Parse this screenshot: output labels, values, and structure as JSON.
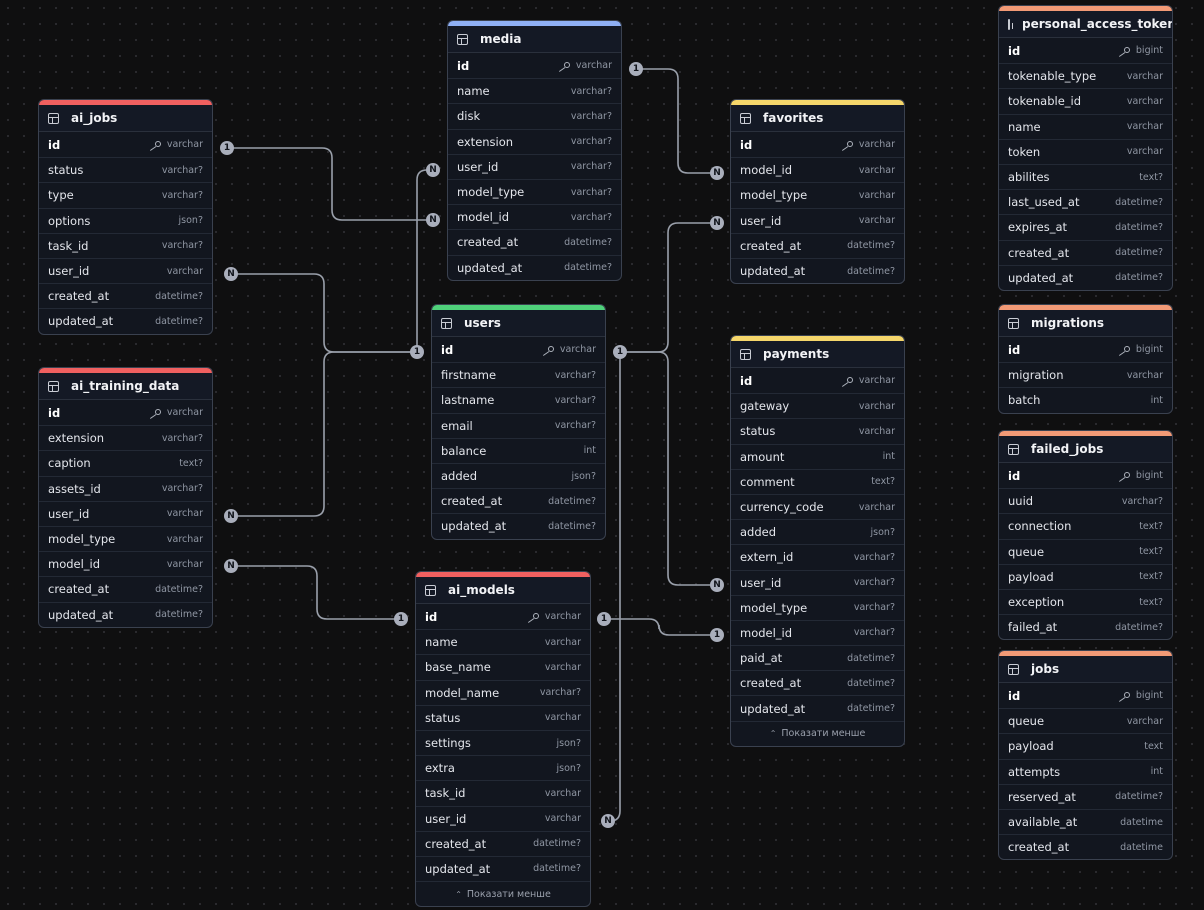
{
  "tables": {
    "media": {
      "name": "media",
      "color": "#8fb0f5",
      "columns": [
        {
          "name": "id",
          "type": "varchar",
          "pk": true
        },
        {
          "name": "name",
          "type": "varchar?"
        },
        {
          "name": "disk",
          "type": "varchar?"
        },
        {
          "name": "extension",
          "type": "varchar?"
        },
        {
          "name": "user_id",
          "type": "varchar?"
        },
        {
          "name": "model_type",
          "type": "varchar?"
        },
        {
          "name": "model_id",
          "type": "varchar?"
        },
        {
          "name": "created_at",
          "type": "datetime?"
        },
        {
          "name": "updated_at",
          "type": "datetime?"
        }
      ]
    },
    "ai_jobs": {
      "name": "ai_jobs",
      "color": "#f06060",
      "columns": [
        {
          "name": "id",
          "type": "varchar",
          "pk": true
        },
        {
          "name": "status",
          "type": "varchar?"
        },
        {
          "name": "type",
          "type": "varchar?"
        },
        {
          "name": "options",
          "type": "json?"
        },
        {
          "name": "task_id",
          "type": "varchar?"
        },
        {
          "name": "user_id",
          "type": "varchar"
        },
        {
          "name": "created_at",
          "type": "datetime?"
        },
        {
          "name": "updated_at",
          "type": "datetime?"
        }
      ]
    },
    "favorites": {
      "name": "favorites",
      "color": "#f5d66b",
      "columns": [
        {
          "name": "id",
          "type": "varchar",
          "pk": true
        },
        {
          "name": "model_id",
          "type": "varchar"
        },
        {
          "name": "model_type",
          "type": "varchar"
        },
        {
          "name": "user_id",
          "type": "varchar"
        },
        {
          "name": "created_at",
          "type": "datetime?"
        },
        {
          "name": "updated_at",
          "type": "datetime?"
        }
      ]
    },
    "personal_access_tokens": {
      "name": "personal_access_tokens",
      "color": "#f29a76",
      "columns": [
        {
          "name": "id",
          "type": "bigint",
          "pk": true
        },
        {
          "name": "tokenable_type",
          "type": "varchar"
        },
        {
          "name": "tokenable_id",
          "type": "varchar"
        },
        {
          "name": "name",
          "type": "varchar"
        },
        {
          "name": "token",
          "type": "varchar"
        },
        {
          "name": "abilites",
          "type": "text?"
        },
        {
          "name": "last_used_at",
          "type": "datetime?"
        },
        {
          "name": "expires_at",
          "type": "datetime?"
        },
        {
          "name": "created_at",
          "type": "datetime?"
        },
        {
          "name": "updated_at",
          "type": "datetime?"
        }
      ]
    },
    "users": {
      "name": "users",
      "color": "#4fd17a",
      "columns": [
        {
          "name": "id",
          "type": "varchar",
          "pk": true
        },
        {
          "name": "firstname",
          "type": "varchar?"
        },
        {
          "name": "lastname",
          "type": "varchar?"
        },
        {
          "name": "email",
          "type": "varchar?"
        },
        {
          "name": "balance",
          "type": "int"
        },
        {
          "name": "added",
          "type": "json?"
        },
        {
          "name": "created_at",
          "type": "datetime?"
        },
        {
          "name": "updated_at",
          "type": "datetime?"
        }
      ]
    },
    "ai_training_data": {
      "name": "ai_training_data",
      "color": "#f06060",
      "columns": [
        {
          "name": "id",
          "type": "varchar",
          "pk": true
        },
        {
          "name": "extension",
          "type": "varchar?"
        },
        {
          "name": "caption",
          "type": "text?"
        },
        {
          "name": "assets_id",
          "type": "varchar?"
        },
        {
          "name": "user_id",
          "type": "varchar"
        },
        {
          "name": "model_type",
          "type": "varchar"
        },
        {
          "name": "model_id",
          "type": "varchar"
        },
        {
          "name": "created_at",
          "type": "datetime?"
        },
        {
          "name": "updated_at",
          "type": "datetime?"
        }
      ]
    },
    "payments": {
      "name": "payments",
      "color": "#f5d66b",
      "showless": "Показати менше",
      "columns": [
        {
          "name": "id",
          "type": "varchar",
          "pk": true
        },
        {
          "name": "gateway",
          "type": "varchar"
        },
        {
          "name": "status",
          "type": "varchar"
        },
        {
          "name": "amount",
          "type": "int"
        },
        {
          "name": "comment",
          "type": "text?"
        },
        {
          "name": "currency_code",
          "type": "varchar"
        },
        {
          "name": "added",
          "type": "json?"
        },
        {
          "name": "extern_id",
          "type": "varchar?"
        },
        {
          "name": "user_id",
          "type": "varchar?"
        },
        {
          "name": "model_type",
          "type": "varchar?"
        },
        {
          "name": "model_id",
          "type": "varchar?"
        },
        {
          "name": "paid_at",
          "type": "datetime?"
        },
        {
          "name": "created_at",
          "type": "datetime?"
        },
        {
          "name": "updated_at",
          "type": "datetime?"
        }
      ]
    },
    "migrations": {
      "name": "migrations",
      "color": "#f29a76",
      "columns": [
        {
          "name": "id",
          "type": "bigint",
          "pk": true
        },
        {
          "name": "migration",
          "type": "varchar"
        },
        {
          "name": "batch",
          "type": "int"
        }
      ]
    },
    "failed_jobs": {
      "name": "failed_jobs",
      "color": "#f29a76",
      "columns": [
        {
          "name": "id",
          "type": "bigint",
          "pk": true
        },
        {
          "name": "uuid",
          "type": "varchar?"
        },
        {
          "name": "connection",
          "type": "text?"
        },
        {
          "name": "queue",
          "type": "text?"
        },
        {
          "name": "payload",
          "type": "text?"
        },
        {
          "name": "exception",
          "type": "text?"
        },
        {
          "name": "failed_at",
          "type": "datetime?"
        }
      ]
    },
    "ai_models": {
      "name": "ai_models",
      "color": "#f06060",
      "showless": "Показати менше",
      "columns": [
        {
          "name": "id",
          "type": "varchar",
          "pk": true
        },
        {
          "name": "name",
          "type": "varchar"
        },
        {
          "name": "base_name",
          "type": "varchar"
        },
        {
          "name": "model_name",
          "type": "varchar?"
        },
        {
          "name": "status",
          "type": "varchar"
        },
        {
          "name": "settings",
          "type": "json?"
        },
        {
          "name": "extra",
          "type": "json?"
        },
        {
          "name": "task_id",
          "type": "varchar"
        },
        {
          "name": "user_id",
          "type": "varchar"
        },
        {
          "name": "created_at",
          "type": "datetime?"
        },
        {
          "name": "updated_at",
          "type": "datetime?"
        }
      ]
    },
    "jobs": {
      "name": "jobs",
      "color": "#f29a76",
      "columns": [
        {
          "name": "id",
          "type": "bigint",
          "pk": true
        },
        {
          "name": "queue",
          "type": "varchar"
        },
        {
          "name": "payload",
          "type": "text"
        },
        {
          "name": "attempts",
          "type": "int"
        },
        {
          "name": "reserved_at",
          "type": "datetime?"
        },
        {
          "name": "available_at",
          "type": "datetime"
        },
        {
          "name": "created_at",
          "type": "datetime"
        }
      ]
    }
  },
  "relations": [
    {
      "from": "media.id",
      "to": "favorites.model_id",
      "from_card": "1",
      "to_card": "N"
    },
    {
      "from": "ai_jobs.id",
      "to": "media.model_id",
      "from_card": "1",
      "to_card": "N"
    },
    {
      "from": "users.id",
      "to": "media.user_id",
      "from_card": "1",
      "to_card": "N"
    },
    {
      "from": "users.id",
      "to": "ai_jobs.user_id",
      "from_card": "1",
      "to_card": "N"
    },
    {
      "from": "users.id",
      "to": "ai_training_data.user_id",
      "from_card": "1",
      "to_card": "N"
    },
    {
      "from": "users.id",
      "to": "favorites.user_id",
      "from_card": "1",
      "to_card": "N"
    },
    {
      "from": "users.id",
      "to": "payments.user_id",
      "from_card": "1",
      "to_card": "N"
    },
    {
      "from": "users.id",
      "to": "ai_models.user_id",
      "from_card": "1",
      "to_card": "N"
    },
    {
      "from": "ai_models.id",
      "to": "ai_training_data.model_id",
      "from_card": "1",
      "to_card": "N"
    },
    {
      "from": "ai_models.id",
      "to": "payments.model_id",
      "from_card": "1",
      "to_card": "1"
    }
  ]
}
